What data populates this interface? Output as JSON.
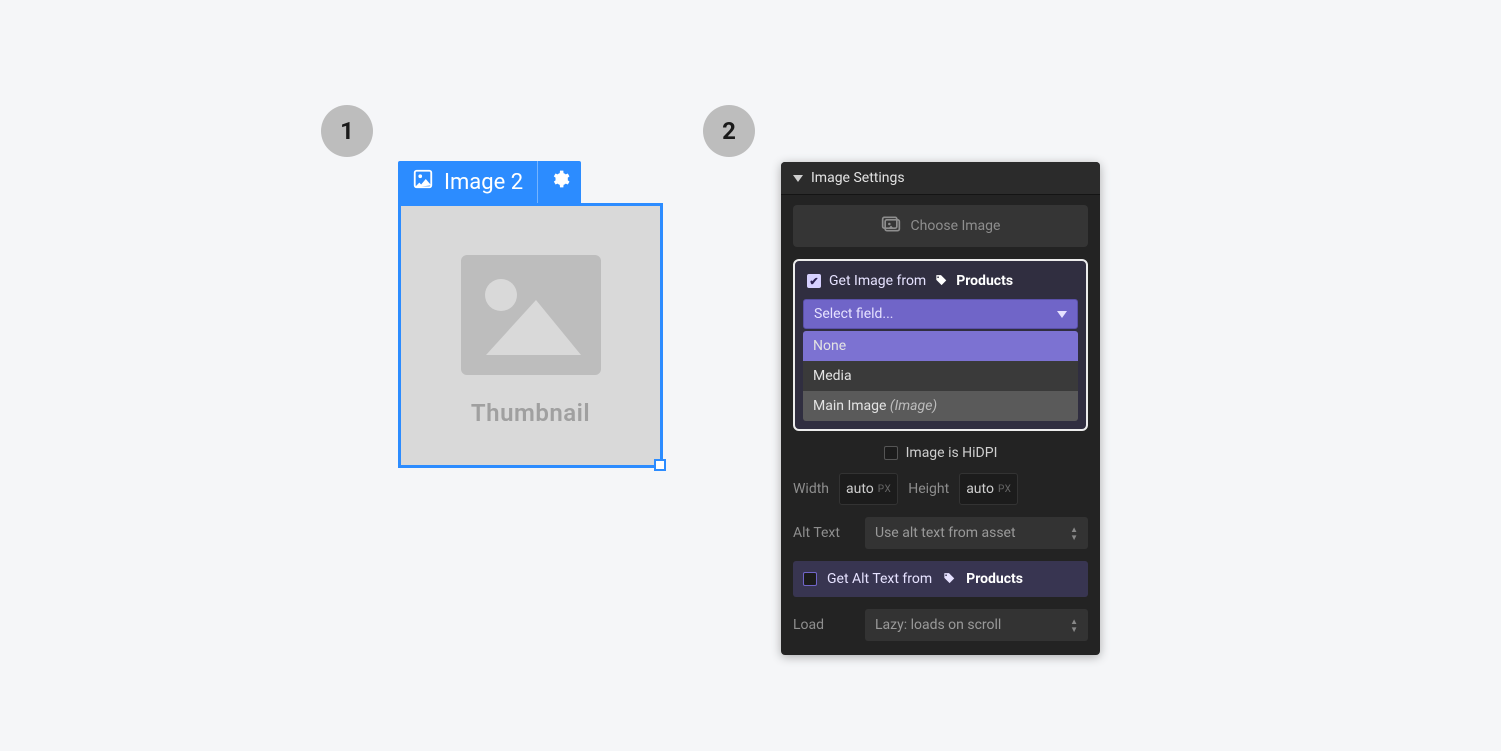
{
  "badges": {
    "one": "1",
    "two": "2"
  },
  "element": {
    "label": "Image 2",
    "placeholder": "Thumbnail"
  },
  "panel": {
    "title": "Image Settings",
    "chooseLabel": "Choose Image",
    "bind": {
      "prefix": "Get Image from",
      "collection": "Products",
      "fieldPlaceholder": "Select field...",
      "options": {
        "none": "None",
        "media": "Media",
        "mainImage": "Main Image",
        "mainImageType": "(Image)"
      }
    },
    "hidpi": "Image is HiDPI",
    "width": {
      "label": "Width",
      "value": "auto",
      "unit": "PX"
    },
    "height": {
      "label": "Height",
      "value": "auto",
      "unit": "PX"
    },
    "altText": {
      "label": "Alt Text",
      "value": "Use alt text from asset"
    },
    "altBind": {
      "prefix": "Get Alt Text from",
      "collection": "Products"
    },
    "load": {
      "label": "Load",
      "value": "Lazy: loads on scroll"
    }
  }
}
